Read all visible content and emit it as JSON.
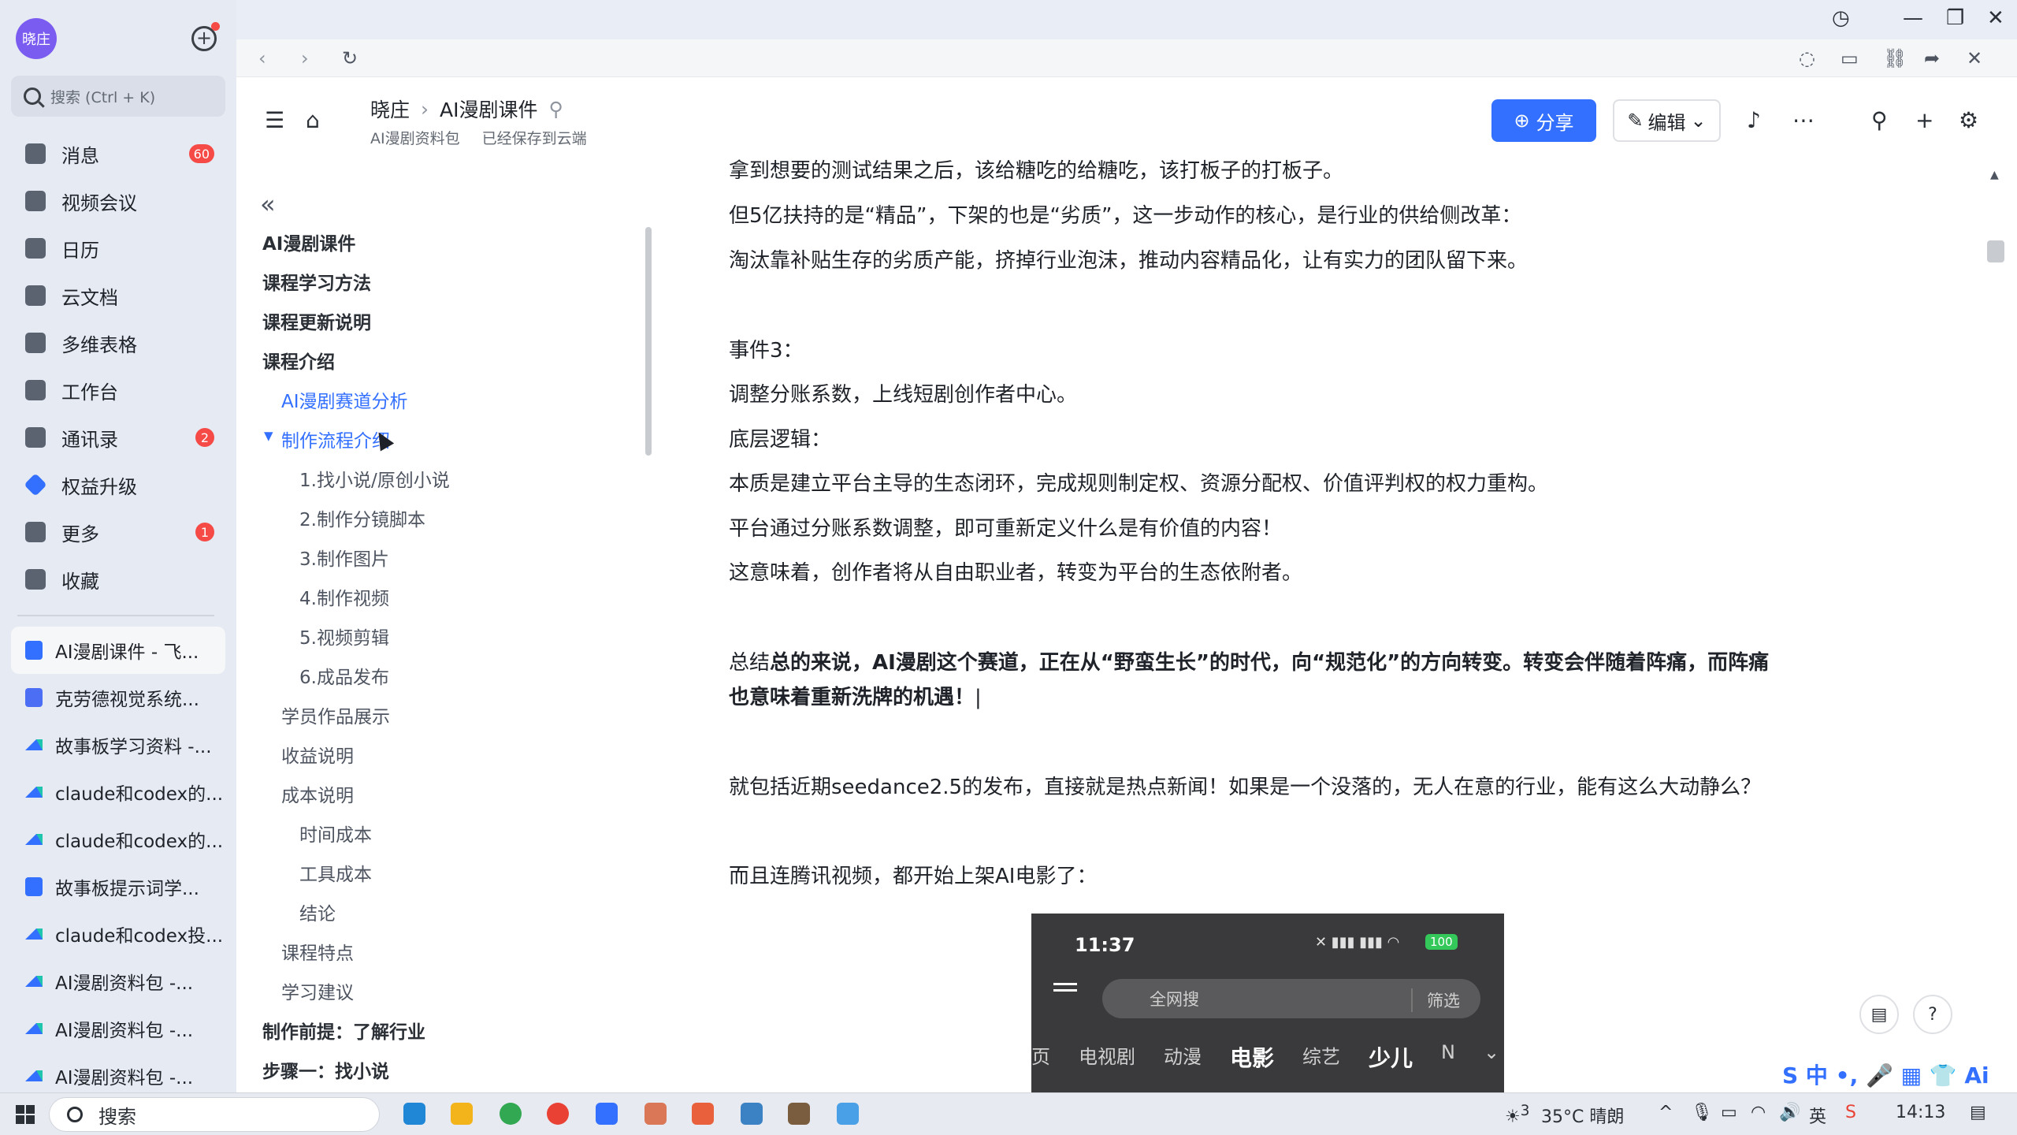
{
  "sidebar": {
    "avatar": "晓庄",
    "search_placeholder": "搜索 (Ctrl + K)",
    "nav": [
      {
        "label": "消息",
        "badge": "60"
      },
      {
        "label": "视频会议",
        "badge": ""
      },
      {
        "label": "日历",
        "badge": ""
      },
      {
        "label": "云文档",
        "badge": ""
      },
      {
        "label": "多维表格",
        "badge": ""
      },
      {
        "label": "工作台",
        "badge": ""
      },
      {
        "label": "通讯录",
        "badge": "2"
      },
      {
        "label": "权益升级",
        "badge": ""
      },
      {
        "label": "更多",
        "badge": "1"
      },
      {
        "label": "收藏",
        "badge": ""
      }
    ],
    "docs": [
      "AI漫剧课件 - 飞...",
      "克劳德视觉系统...",
      "故事板学习资料 -...",
      "claude和codex的...",
      "claude和codex的...",
      "故事板提示词学...",
      "claude和codex投...",
      "AI漫剧资料包 -...",
      "AI漫剧资料包 -...",
      "AI漫剧资料包 -..."
    ]
  },
  "header": {
    "breadcrumb_root": "晓庄",
    "breadcrumb_current": "AI漫剧课件",
    "folder": "AI漫剧资料包",
    "save_status": "已经保存到云端",
    "share_label": "分享",
    "edit_label": "编辑"
  },
  "outline": [
    {
      "label": "AI漫剧课件",
      "level": 1
    },
    {
      "label": "课程学习方法",
      "level": 1
    },
    {
      "label": "课程更新说明",
      "level": 1
    },
    {
      "label": "课程介绍",
      "level": 1
    },
    {
      "label": "AI漫剧赛道分析",
      "level": 2
    },
    {
      "label": "制作流程介绍",
      "level": 2
    },
    {
      "label": "1.找小说/原创小说",
      "level": 3
    },
    {
      "label": "2.制作分镜脚本",
      "level": 3
    },
    {
      "label": "3.制作图片",
      "level": 3
    },
    {
      "label": "4.制作视频",
      "level": 3
    },
    {
      "label": "5.视频剪辑",
      "level": 3
    },
    {
      "label": "6.成品发布",
      "level": 3
    },
    {
      "label": "学员作品展示",
      "level": 2
    },
    {
      "label": "收益说明",
      "level": 2
    },
    {
      "label": "成本说明",
      "level": 2
    },
    {
      "label": "时间成本",
      "level": 3
    },
    {
      "label": "工具成本",
      "level": 3
    },
    {
      "label": "结论",
      "level": 3
    },
    {
      "label": "课程特点",
      "level": 2
    },
    {
      "label": "学习建议",
      "level": 2
    },
    {
      "label": "制作前提：了解行业",
      "level": 1
    },
    {
      "label": "步骤一：找小说",
      "level": 1
    }
  ],
  "content": {
    "p1": "拿到想要的测试结果之后，该给糖吃的给糖吃，该打板子的打板子。",
    "p2": "但5亿扶持的是“精品”，下架的也是“劣质”，这一步动作的核心，是行业的供给侧改革：",
    "p3": "淘汰靠补贴生存的劣质产能，挤掉行业泡沫，推动内容精品化，让有实力的团队留下来。",
    "p4": "事件3：",
    "p5": "调整分账系数，上线短剧创作者中心。",
    "p6": "底层逻辑：",
    "p7": "本质是建立平台主导的生态闭环，完成规则制定权、资源分配权、价值评判权的权力重构。",
    "p8": "平台通过分账系数调整，即可重新定义什么是有价值的内容！",
    "p9": "这意味着，创作者将从自由职业者，转变为平台的生态依附者。",
    "summary_prefix": "总结",
    "summary_bold_1": "总的来说，AI漫剧这个赛道，正在从“野蛮生长”的时代，向“规范化”的方向转变。转变会伴随着阵痛，而阵痛",
    "summary_bold_2": "也意味着重新洗牌的机遇！",
    "p10": "就包括近期seedance2.5的发布，直接就是热点新闻！如果是一个没落的，无人在意的行业，能有这么大动静么？",
    "p11": "而且连腾讯视频，都开始上架AI电影了："
  },
  "phone": {
    "time": "11:37",
    "battery": "100",
    "search_placeholder": "全网搜",
    "filter": "筛选",
    "categories": [
      "页",
      "电视剧",
      "动漫",
      "电影",
      "综艺",
      "少儿",
      "N"
    ]
  },
  "taskbar": {
    "search": "搜索",
    "weather": "35°C 晴朗",
    "weather_badge": "3",
    "time": "14:13",
    "ime": "中 •, 🎤 ▦ 👕 Ai"
  }
}
